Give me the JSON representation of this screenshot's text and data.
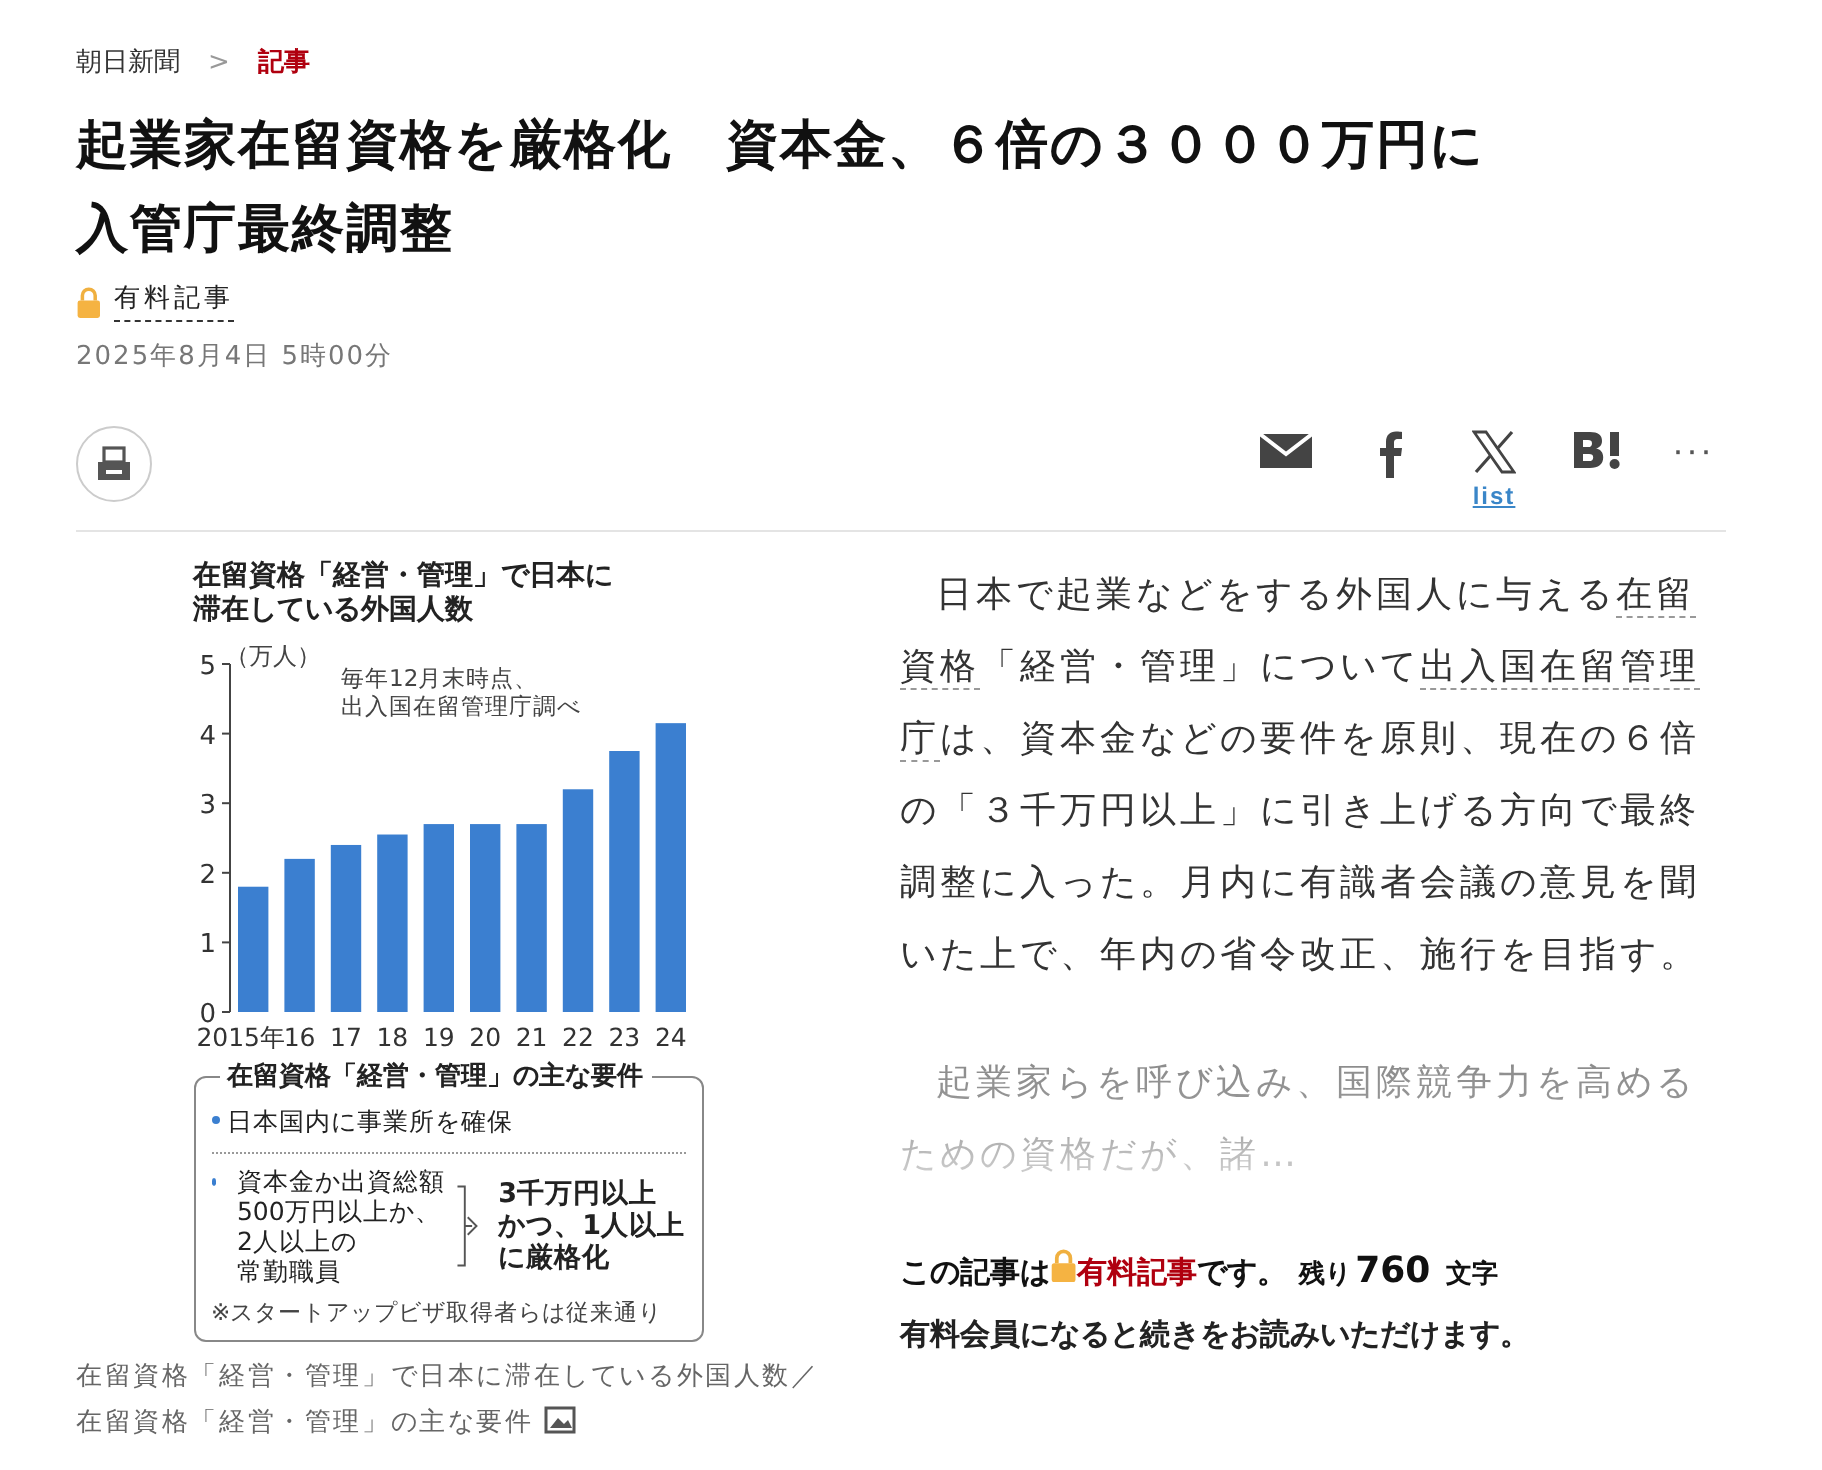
{
  "breadcrumb": [
    {
      "label": "朝日新聞",
      "current": false
    },
    {
      "label": "記事",
      "current": true
    }
  ],
  "breadcrumb_separator": ">",
  "title_lines": [
    "起業家在留資格を厳格化　資本金、６倍の３０００万円に",
    "入管庁最終調整"
  ],
  "paid_tag": "有料記事",
  "date": "2025年8月4日 5時00分",
  "share_list_label": "list",
  "share_more": "···",
  "figure": {
    "title_lines": [
      "在留資格「経営・管理」で日本に",
      "滞在している外国人数"
    ],
    "unit": "（万人）",
    "note_lines": [
      "毎年12月末時点、",
      "出入国在留管理庁調べ"
    ],
    "chart_data": {
      "type": "bar",
      "categories": [
        "2015年",
        "16",
        "17",
        "18",
        "19",
        "20",
        "21",
        "22",
        "23",
        "24"
      ],
      "series": [
        {
          "color": "#3b7fd0",
          "values": [
            1.8,
            2.2,
            2.4,
            2.55,
            2.7,
            2.7,
            2.7,
            3.2,
            3.75,
            4.15
          ]
        }
      ],
      "ylim": [
        0,
        5
      ],
      "yticks": [
        0,
        1,
        2,
        3,
        4,
        5
      ]
    },
    "requirements": {
      "title": "在留資格「経営・管理」の主な要件",
      "item_1": "日本国内に事業所を確保",
      "item_2_lines": [
        "資本金か出資総額",
        "500万円以上か、",
        "2人以上の",
        "常勤職員"
      ],
      "result_lines": [
        "3千万円以上",
        "かつ、1人以上",
        "に厳格化"
      ],
      "note": "※スタートアップビザ取得者らは従来通り"
    }
  },
  "caption": "在留資格「経営・管理」で日本に滞在している外国人数／在留資格「経営・管理」の主な要件",
  "paragraphs": [
    {
      "faded": false,
      "parts": [
        {
          "kind": "text",
          "text": "日本で起業などをする外国人に与える"
        },
        {
          "kind": "link",
          "text": "在留"
        },
        {
          "kind": "link",
          "text": "資格"
        },
        {
          "kind": "text",
          "text": "「経営・管理」について"
        },
        {
          "kind": "link",
          "text": "出入国在留管理"
        },
        {
          "kind": "link",
          "text": "庁"
        },
        {
          "kind": "text",
          "text": "は、資本金などの要件を原則、現在の６倍の「３千万円以上」に引き上げる方向で最終調整に入った。月内に有識者会議の意見を聞いた上で、年内の省令改正、施行を目指す。"
        }
      ]
    },
    {
      "faded": true,
      "parts": [
        {
          "kind": "text",
          "text": "起業家らを呼び込み、国際競争力を高めるための資格だが、諸…"
        }
      ]
    }
  ],
  "paywall": {
    "lead": "この記事は",
    "paid_label": "有料記事",
    "after": "です。",
    "remaining_label": "残り",
    "remaining_count": "760",
    "remaining_unit": "文字",
    "note": "有料会員になると続きをお読みいただけます。"
  }
}
